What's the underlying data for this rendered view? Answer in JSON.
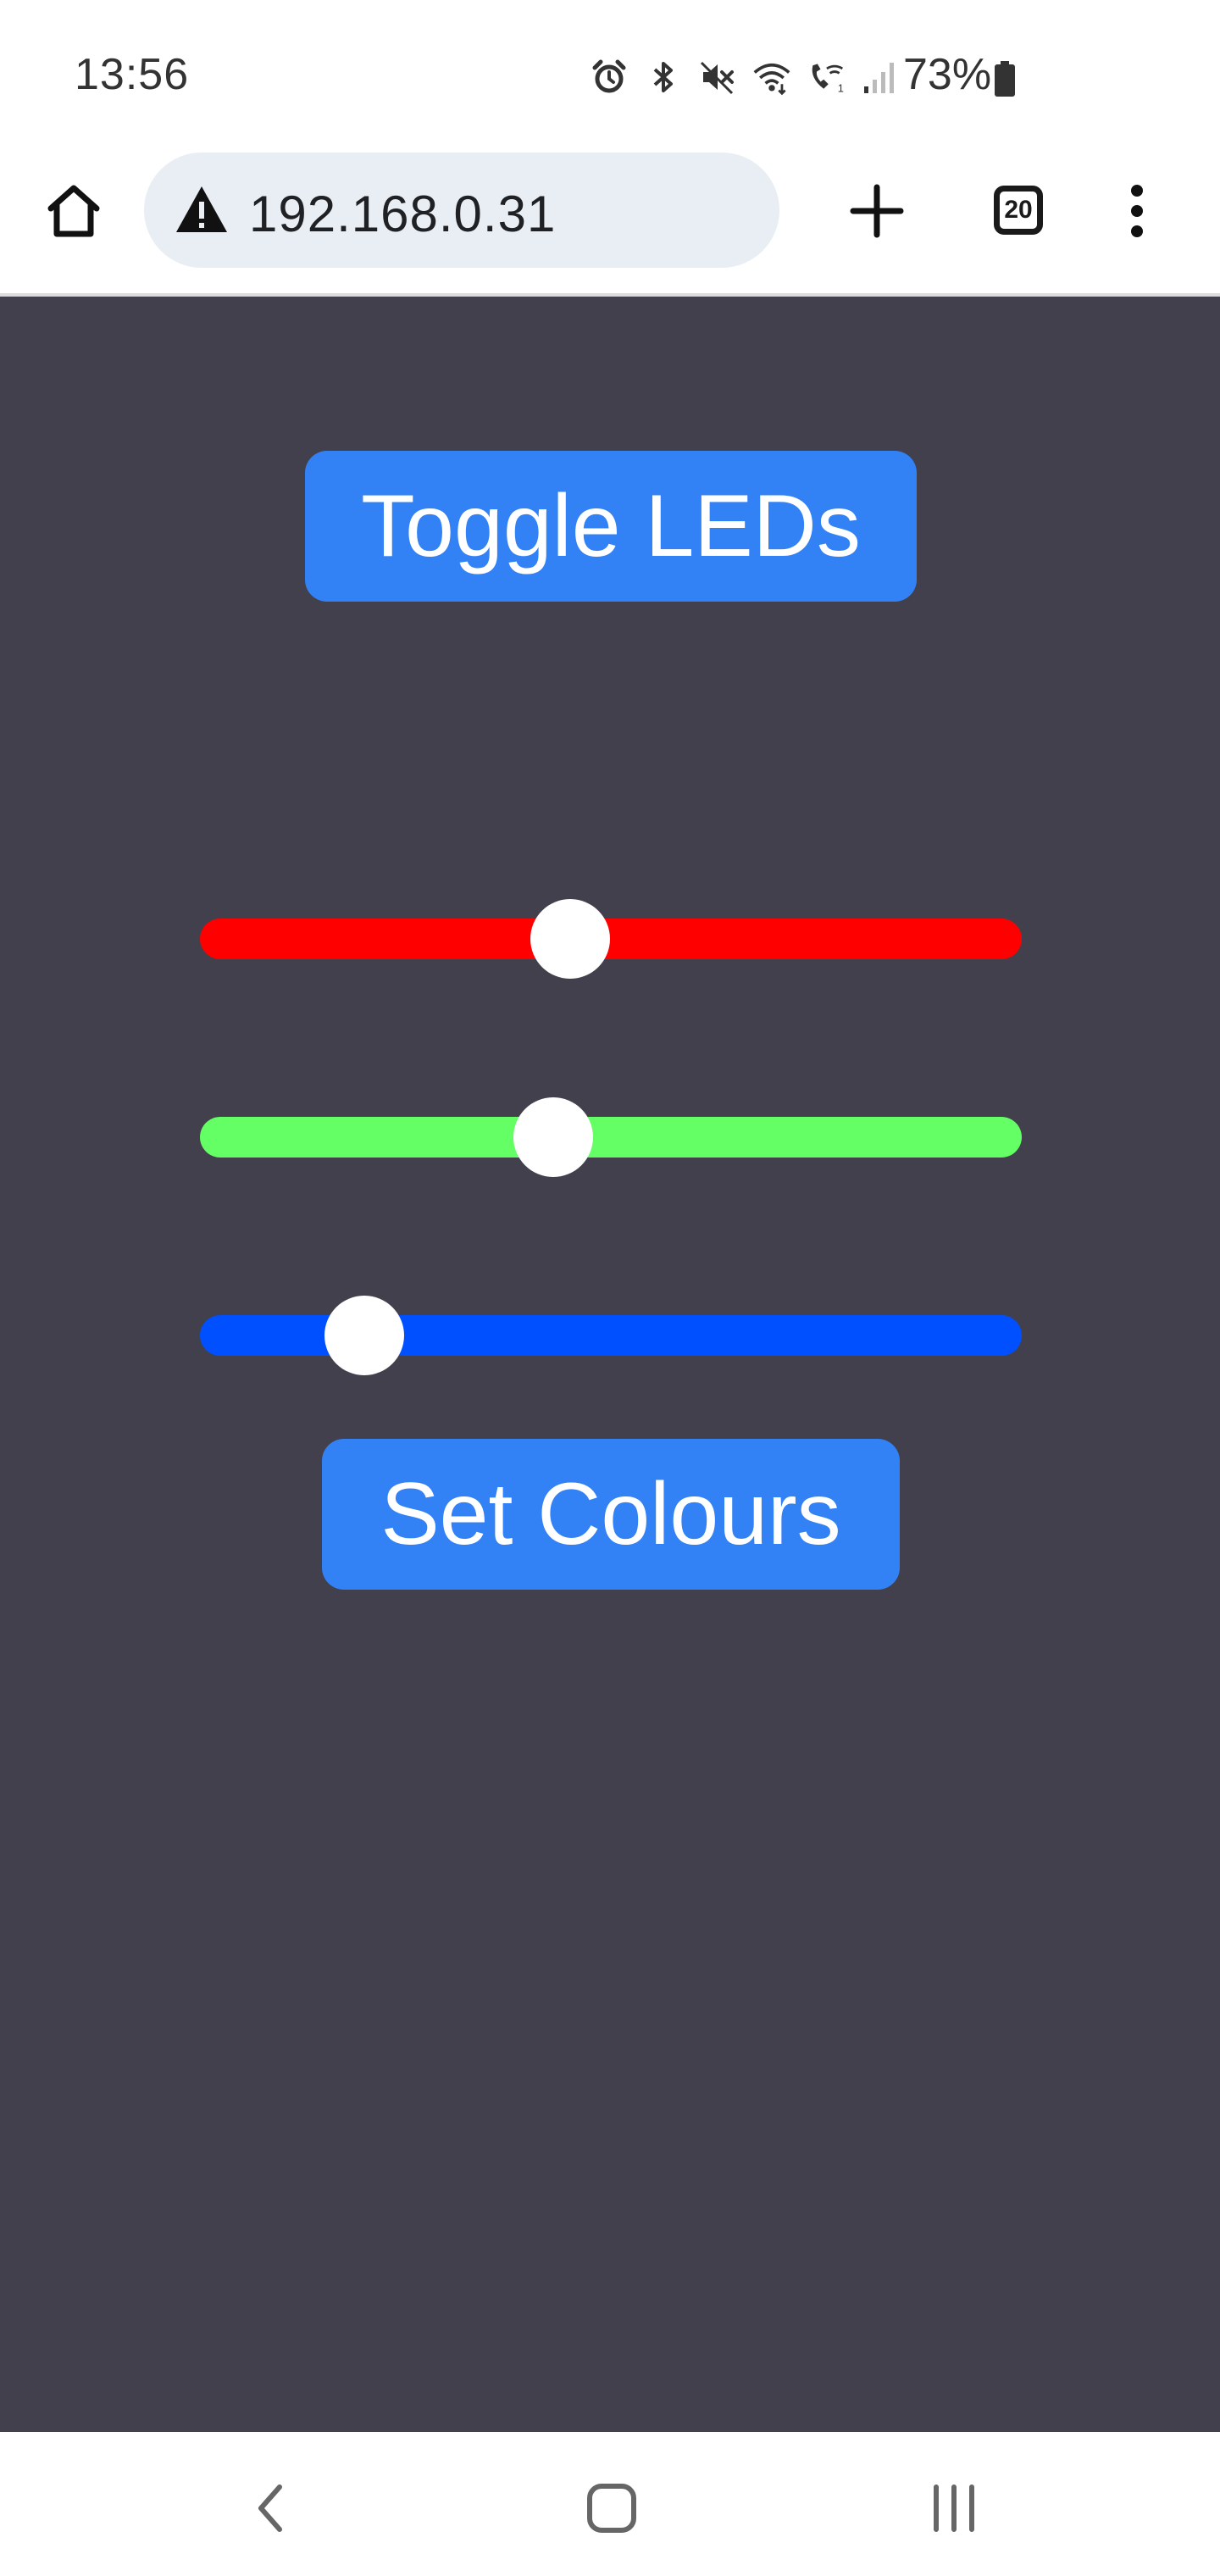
{
  "status_bar": {
    "time": "13:56",
    "battery_text": "73%",
    "icons": [
      "alarm-icon",
      "bluetooth-icon",
      "mute-icon",
      "wifi-icon",
      "wifi-calling-icon",
      "signal-icon",
      "battery-icon"
    ]
  },
  "browser": {
    "url": "192.168.0.31",
    "tab_count": "20",
    "security_icon": "warning-icon"
  },
  "page": {
    "toggle_button_label": "Toggle LEDs",
    "set_button_label": "Set Colours",
    "sliders": [
      {
        "name": "red",
        "color": "#ff0000",
        "value": 0.45
      },
      {
        "name": "green",
        "color": "#64ff64",
        "value": 0.43
      },
      {
        "name": "blue",
        "color": "#0050ff",
        "value": 0.2
      }
    ],
    "background_color": "#41404c",
    "button_color": "#3282f6"
  },
  "nav_bar": {
    "icons": [
      "back-icon",
      "home-icon",
      "recents-icon"
    ]
  }
}
